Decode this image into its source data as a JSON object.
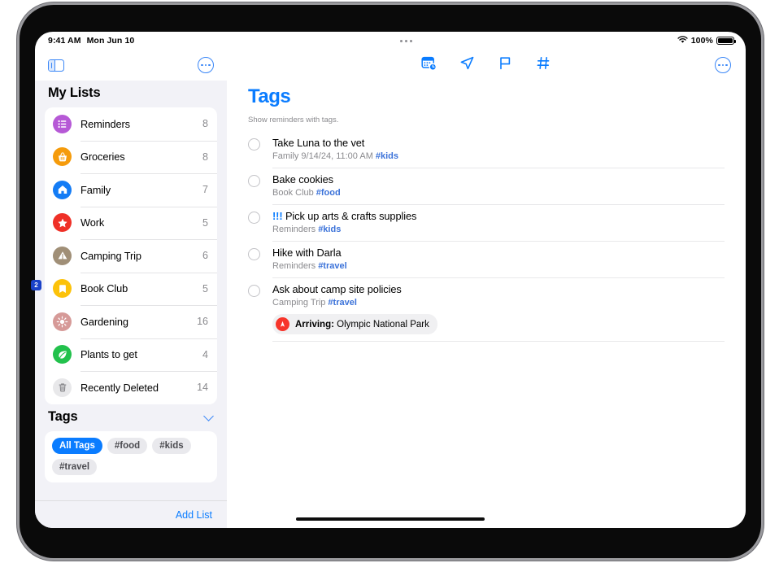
{
  "status_bar": {
    "time": "9:41 AM",
    "date": "Mon Jun 10",
    "battery_percent": "100%",
    "wifi_icon": "wifi-icon",
    "battery_icon": "battery-full-icon",
    "multitask_icon": "multitasking-dots-icon"
  },
  "sidebar": {
    "toggle_icon": "sidebar-toggle-icon",
    "more_icon": "more-ellipsis-icon",
    "my_lists_heading": "My Lists",
    "lists": [
      {
        "label": "Reminders",
        "count": "8",
        "icon": "list-bullet-icon",
        "color": "#b659d6"
      },
      {
        "label": "Groceries",
        "count": "8",
        "icon": "basket-icon",
        "color": "#f59b0b"
      },
      {
        "label": "Family",
        "count": "7",
        "icon": "house-icon",
        "color": "#147cf5"
      },
      {
        "label": "Work",
        "count": "5",
        "icon": "star-icon",
        "color": "#ef3027"
      },
      {
        "label": "Camping Trip",
        "count": "6",
        "icon": "tent-icon",
        "color": "#a08f77"
      },
      {
        "label": "Book Club",
        "count": "5",
        "icon": "bookmark-icon",
        "color": "#fcc20a"
      },
      {
        "label": "Gardening",
        "count": "16",
        "icon": "sun-sparkle-icon",
        "color": "#d69a98"
      },
      {
        "label": "Plants to get",
        "count": "4",
        "icon": "leaf-icon",
        "color": "#22c14c"
      },
      {
        "label": "Recently Deleted",
        "count": "14",
        "icon": "trash-icon",
        "color": "#e8e8ea"
      }
    ],
    "tags_heading": "Tags",
    "tags_collapse_icon": "chevron-down-icon",
    "tag_chips": [
      {
        "label": "All Tags",
        "active": true
      },
      {
        "label": "#food",
        "active": false
      },
      {
        "label": "#kids",
        "active": false
      },
      {
        "label": "#travel",
        "active": false
      }
    ],
    "add_list_label": "Add List"
  },
  "main": {
    "toolbar_icons": [
      "scheduled-calendar-icon",
      "today-location-arrow-icon",
      "flagged-flag-icon",
      "tags-hash-icon"
    ],
    "more_icon": "more-ellipsis-icon",
    "title": "Tags",
    "subtitle": "Show reminders with tags.",
    "reminders": [
      {
        "priority": "",
        "title": "Take Luna to the vet",
        "list": "Family",
        "date": "9/14/24, 11:00 AM",
        "tag": "#kids",
        "location_badge": null
      },
      {
        "priority": "",
        "title": "Bake cookies",
        "list": "Book Club",
        "date": "",
        "tag": "#food",
        "location_badge": null
      },
      {
        "priority": "!!!",
        "title": "Pick up arts & crafts supplies",
        "list": "Reminders",
        "date": "",
        "tag": "#kids",
        "location_badge": null
      },
      {
        "priority": "",
        "title": "Hike with Darla",
        "list": "Reminders",
        "date": "",
        "tag": "#travel",
        "location_badge": null
      },
      {
        "priority": "",
        "title": "Ask about camp site policies",
        "list": "Camping Trip",
        "date": "",
        "tag": "#travel",
        "location_badge": {
          "label": "Arriving:",
          "value": "Olympic National Park",
          "icon": "location-pin-icon"
        }
      }
    ]
  },
  "callout": {
    "number": "2"
  },
  "colors": {
    "accent": "#0a7cff",
    "tag": "#3b72d9",
    "sidebar_bg": "#f2f2f7",
    "alert_red": "#f7352b"
  }
}
